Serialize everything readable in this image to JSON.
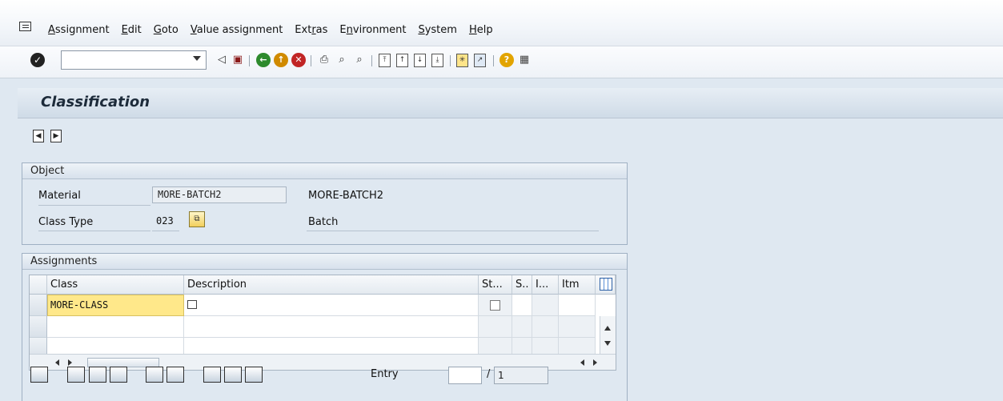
{
  "menu": {
    "items": [
      {
        "pre": "",
        "u": "A",
        "post": "ssignment"
      },
      {
        "pre": "",
        "u": "E",
        "post": "dit"
      },
      {
        "pre": "",
        "u": "G",
        "post": "oto"
      },
      {
        "pre": "",
        "u": "V",
        "post": "alue assignment"
      },
      {
        "pre": "Ext",
        "u": "r",
        "post": "as"
      },
      {
        "pre": "E",
        "u": "n",
        "post": "vironment"
      },
      {
        "pre": "",
        "u": "S",
        "post": "ystem"
      },
      {
        "pre": "",
        "u": "H",
        "post": "elp"
      }
    ]
  },
  "toolbar": {
    "command_value": ""
  },
  "screen": {
    "title": "Classification"
  },
  "object": {
    "header": "Object",
    "material_label": "Material",
    "material_value": "MORE-BATCH2",
    "material_desc": "MORE-BATCH2",
    "class_type_label": "Class Type",
    "class_type_value": "023",
    "class_type_desc": "Batch"
  },
  "assignments": {
    "header": "Assignments",
    "columns": [
      "Class",
      "Description",
      "St...",
      "S..",
      "I...",
      "Itm"
    ],
    "rows": [
      {
        "class": "MORE-CLASS",
        "description": ""
      },
      {
        "class": "",
        "description": ""
      },
      {
        "class": "",
        "description": ""
      }
    ]
  },
  "footer": {
    "entry_label": "Entry",
    "entry_value": "",
    "entry_total": "1",
    "separator": "/"
  }
}
